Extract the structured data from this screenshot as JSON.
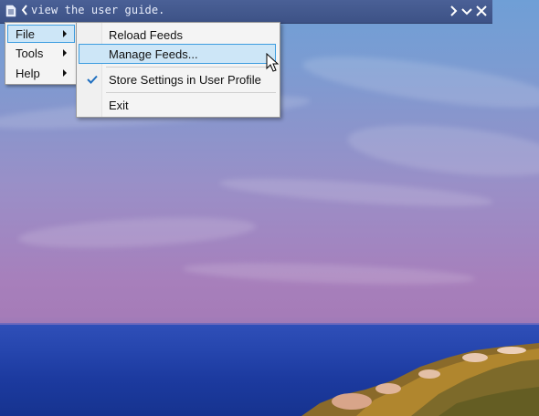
{
  "toolbar": {
    "text": "view the user guide.",
    "icons": [
      "document-icon",
      "chevron-left-icon",
      "chevron-right-icon",
      "chevron-down-icon",
      "close-icon"
    ]
  },
  "menu": {
    "items": [
      {
        "label": "File",
        "active": true
      },
      {
        "label": "Tools",
        "active": false
      },
      {
        "label": "Help",
        "active": false
      }
    ]
  },
  "submenu": {
    "items": [
      {
        "label": "Reload Feeds",
        "checked": false,
        "hover": false
      },
      {
        "label": "Manage Feeds...",
        "checked": false,
        "hover": true
      },
      {
        "label": "Store Settings in User Profile",
        "checked": true,
        "hover": false
      },
      {
        "label": "Exit",
        "checked": false,
        "hover": false
      }
    ]
  },
  "colors": {
    "toolbar": "#4a6096",
    "menu_bg": "#f4f4f4",
    "highlight_bg": "#cde6f7",
    "highlight_border": "#3d9de0",
    "check": "#1f6fc0"
  }
}
